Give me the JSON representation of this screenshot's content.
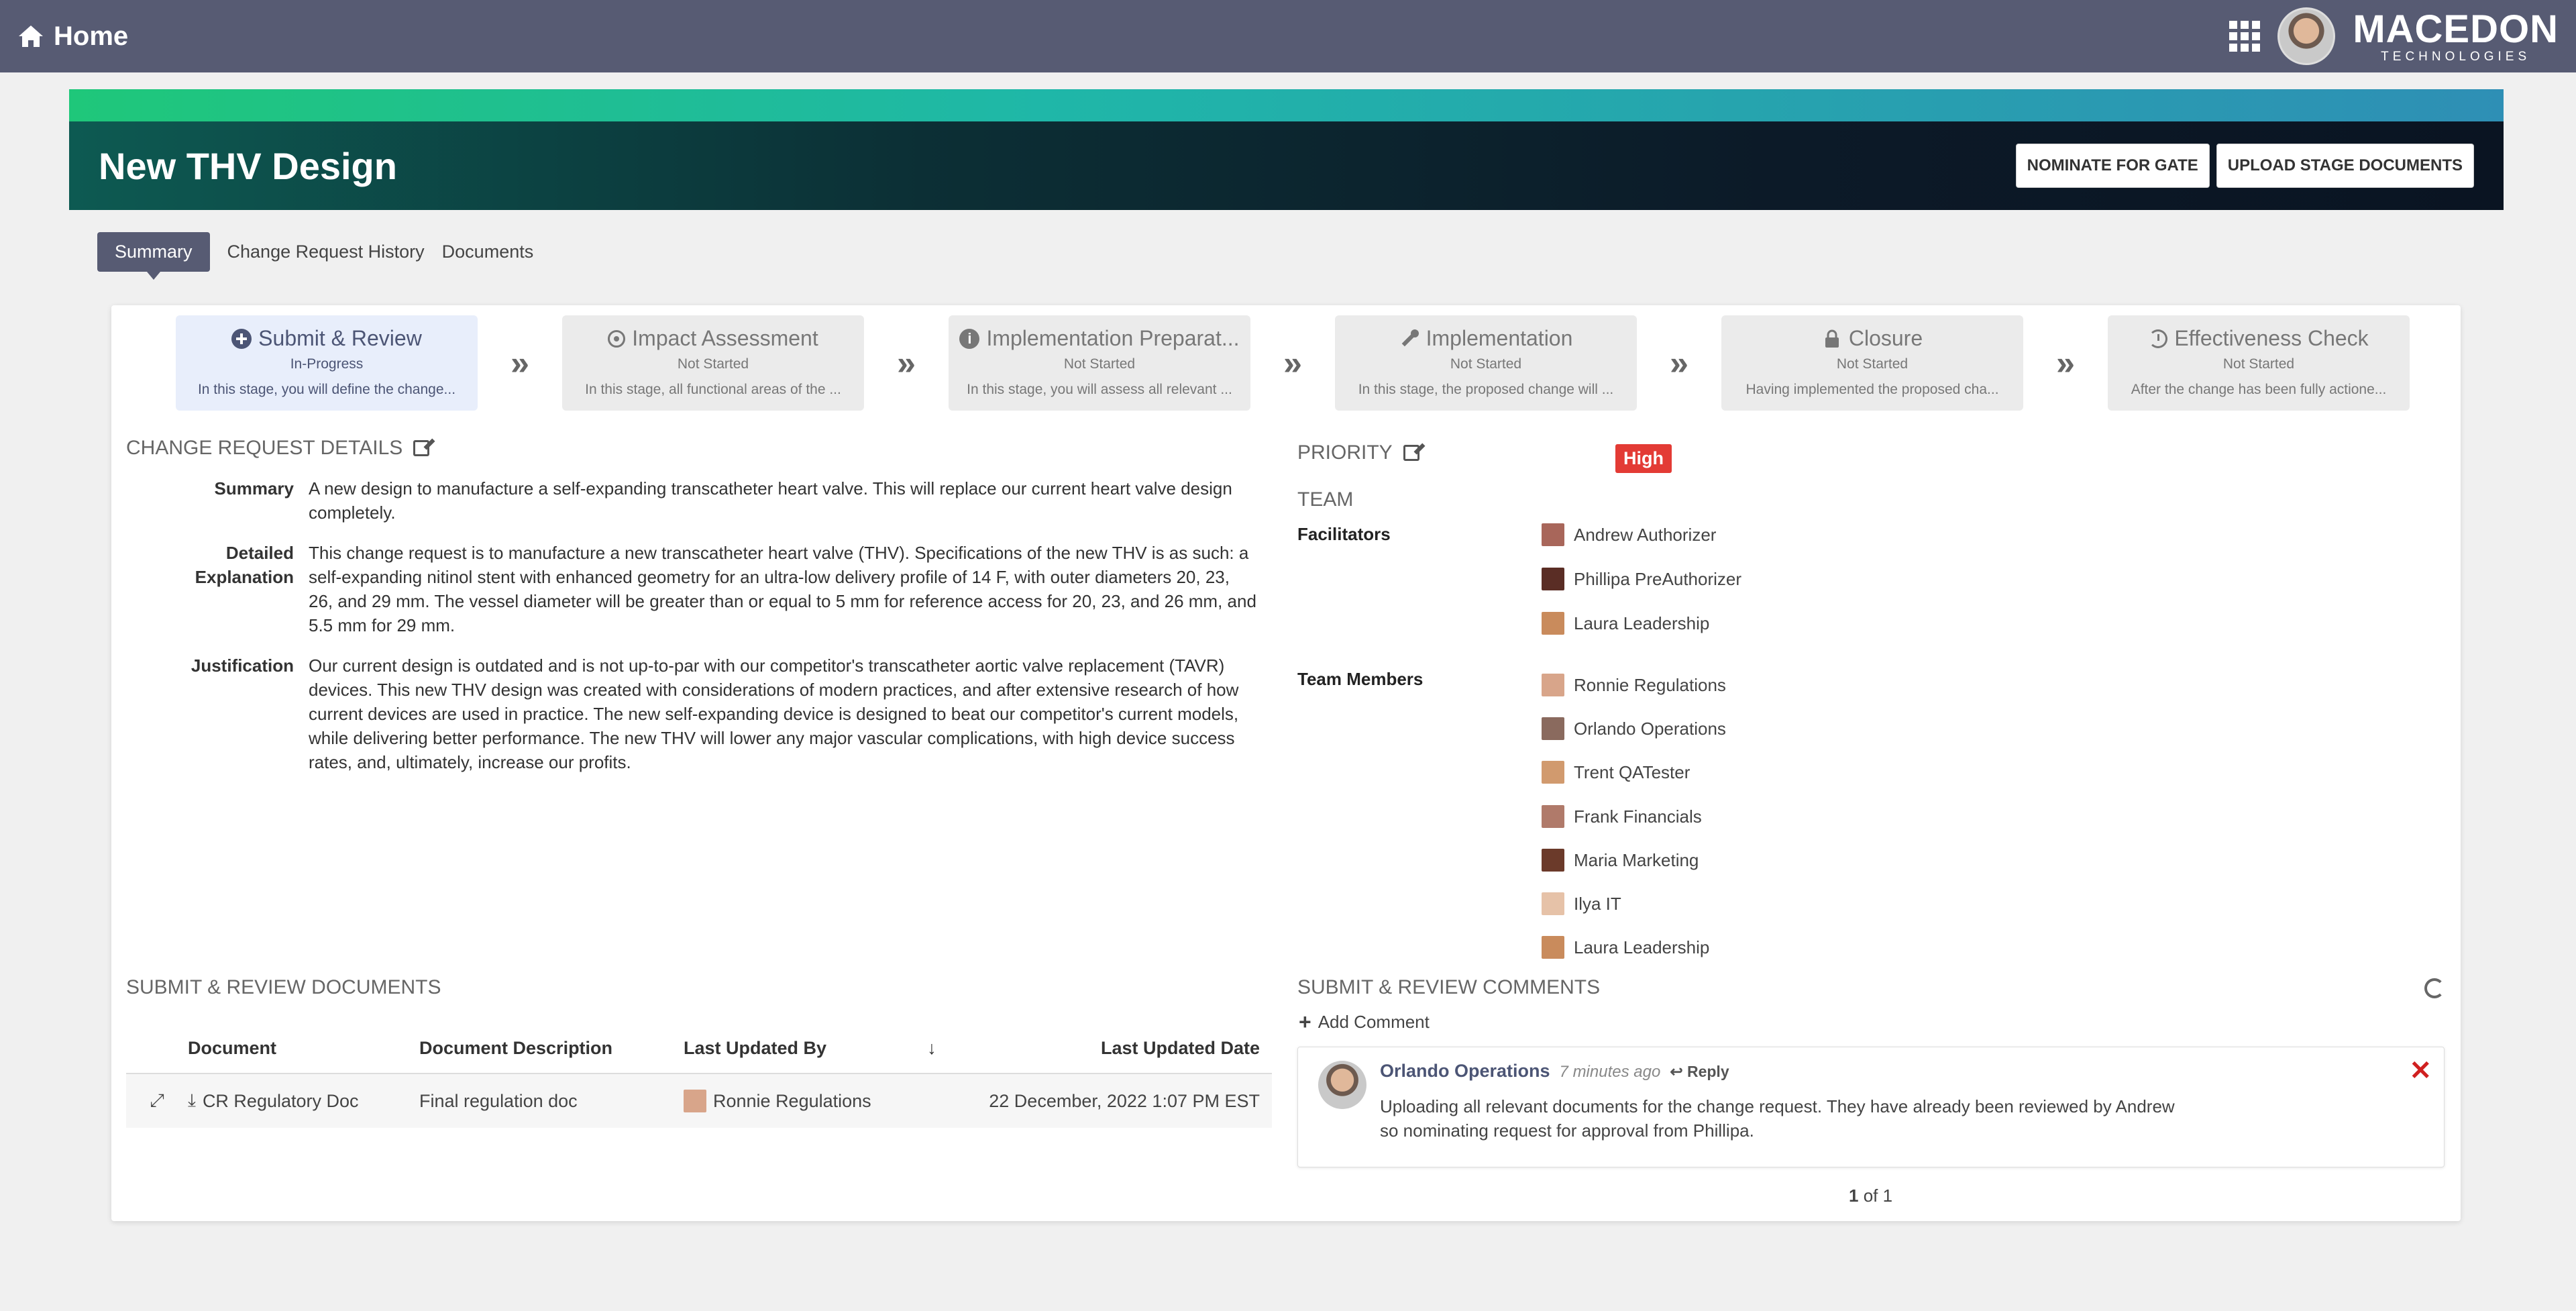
{
  "topnav": {
    "home_label": "Home",
    "logo_line1": "MACEDON",
    "logo_line2": "TECHNOLOGIES"
  },
  "banner": {
    "title": "New THV Design",
    "buttons": [
      "NOMINATE FOR GATE",
      "UPLOAD STAGE DOCUMENTS"
    ]
  },
  "tabs": [
    "Summary",
    "Change Request History",
    "Documents"
  ],
  "stages": [
    {
      "title": "Submit & Review",
      "status": "In-Progress",
      "desc": "In this stage, you will define the change...",
      "icon": "plus-circle-icon"
    },
    {
      "title": "Impact Assessment",
      "status": "Not Started",
      "desc": "In this stage, all functional areas of the ...",
      "icon": "target-icon"
    },
    {
      "title": "Implementation Preparat...",
      "status": "Not Started",
      "desc": "In this stage, you will assess all relevant ...",
      "icon": "info-icon"
    },
    {
      "title": "Implementation",
      "status": "Not Started",
      "desc": "In this stage, the proposed change will ...",
      "icon": "wrench-icon"
    },
    {
      "title": "Closure",
      "status": "Not Started",
      "desc": "Having implemented the proposed cha...",
      "icon": "lock-icon"
    },
    {
      "title": "Effectiveness Check",
      "status": "Not Started",
      "desc": "After the change has been fully actione...",
      "icon": "history-icon"
    }
  ],
  "details": {
    "heading": "CHANGE REQUEST DETAILS",
    "rows": [
      {
        "label": "Summary",
        "value": "A new design to manufacture a self-expanding transcatheter heart valve. This will replace our current heart valve design completely."
      },
      {
        "label": "Detailed Explanation",
        "value": "This change request is to manufacture a new transcatheter heart valve (THV). Specifications of the new THV is as such: a self-expanding nitinol stent with enhanced geometry for an ultra-low delivery profile of 14 F, with outer diameters 20, 23, 26, and 29 mm. The vessel diameter will be greater than or equal to 5 mm for reference access for 20, 23, and 26 mm, and 5.5 mm for 29 mm."
      },
      {
        "label": "Justification",
        "value": "Our current design is outdated and is not up-to-par with our competitor's transcatheter aortic valve replacement (TAVR) devices. This new THV design was created with considerations of modern practices, and after extensive research of how current devices are used in practice. The new self-expanding device is designed to beat our competitor's current models, while delivering better performance. The new THV will lower any major vascular complications, with high device success rates, and, ultimately, increase our profits."
      }
    ]
  },
  "priority": {
    "heading": "PRIORITY",
    "value": "High"
  },
  "team": {
    "heading": "TEAM",
    "facilitators_label": "Facilitators",
    "facilitators": [
      "Andrew Authorizer",
      "Phillipa PreAuthorizer",
      "Laura Leadership"
    ],
    "members_label": "Team Members",
    "members": [
      "Ronnie Regulations",
      "Orlando Operations",
      "Trent QATester",
      "Frank Financials",
      "Maria Marketing",
      "Ilya IT",
      "Laura Leadership"
    ]
  },
  "documents": {
    "heading": "SUBMIT & REVIEW DOCUMENTS",
    "columns": [
      "Document",
      "Document Description",
      "Last Updated By",
      "Last Updated Date"
    ],
    "rows": [
      {
        "document": "CR Regulatory Doc",
        "description": "Final regulation doc",
        "updated_by": "Ronnie Regulations",
        "updated_date": "22 December, 2022 1:07 PM  EST"
      }
    ]
  },
  "comments": {
    "heading": "SUBMIT & REVIEW COMMENTS",
    "add_label": "Add Comment",
    "items": [
      {
        "author": "Orlando Operations",
        "time": "7 minutes ago",
        "reply_label": "Reply",
        "body": "Uploading all relevant documents for the change request. They have already been reviewed by Andrew so nominating request for approval from Phillipa."
      }
    ],
    "pager": {
      "current": "1",
      "sep": "of",
      "total": "1"
    }
  },
  "colors": {
    "nav": "#575b73",
    "priority": "#e33b35",
    "accent": "#4c5575"
  }
}
